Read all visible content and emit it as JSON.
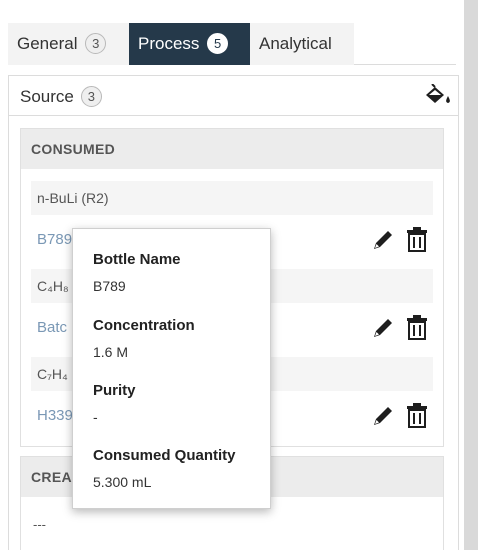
{
  "tabs": [
    {
      "label": "General",
      "count": "3",
      "active": false
    },
    {
      "label": "Process",
      "count": "5",
      "active": true
    },
    {
      "label": "Analytical",
      "active": false
    }
  ],
  "source_panel": {
    "title": "Source",
    "count": "3",
    "icon": "paint-bucket-icon"
  },
  "consumed": {
    "header": "CONSUMED",
    "groups": [
      {
        "material": "n-BuLi (R2)",
        "item": "B789"
      },
      {
        "material": "C₄H₈",
        "item": "Batc"
      },
      {
        "material": "C₇H₄",
        "item": "H339"
      }
    ],
    "icons": {
      "edit": "pencil-icon",
      "delete": "trash-icon"
    }
  },
  "created": {
    "header": "CREA",
    "empty_text": "---"
  },
  "tooltip": {
    "fields": [
      {
        "label": "Bottle Name",
        "value": "B789"
      },
      {
        "label": "Concentration",
        "value": "1.6 M"
      },
      {
        "label": "Purity",
        "value": "-"
      },
      {
        "label": "Consumed Quantity",
        "value": "5.300 mL"
      }
    ]
  },
  "colors": {
    "active_tab": "#25394a",
    "link": "#7a98b5",
    "section_header_bg": "#ececec"
  }
}
